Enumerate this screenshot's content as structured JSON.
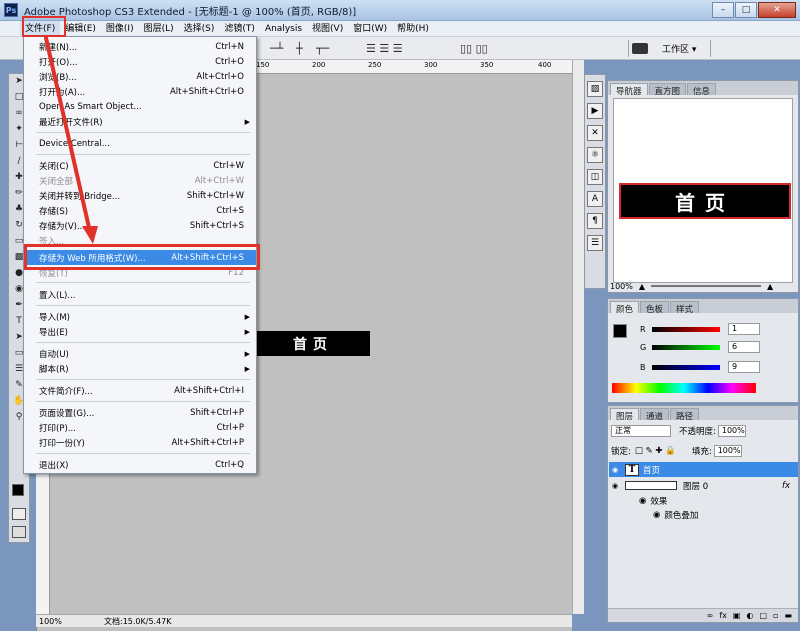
{
  "window": {
    "title": "Adobe Photoshop CS3 Extended - [无标题-1 @ 100% (首页, RGB/8)]",
    "logo": "Ps"
  },
  "menubar": [
    "文件(F)",
    "编辑(E)",
    "图像(I)",
    "图层(L)",
    "选择(S)",
    "滤镜(T)",
    "Analysis",
    "视图(V)",
    "窗口(W)",
    "帮助(H)"
  ],
  "optionsbar": {
    "workspace_label": "工作区 ▾"
  },
  "file_menu": [
    {
      "label": "新建(N)...",
      "shortcut": "Ctrl+N"
    },
    {
      "label": "打开(O)...",
      "shortcut": "Ctrl+O"
    },
    {
      "label": "浏览(B)...",
      "shortcut": "Alt+Ctrl+O"
    },
    {
      "label": "打开为(A)...",
      "shortcut": "Alt+Shift+Ctrl+O"
    },
    {
      "label": "Open As Smart Object...",
      "shortcut": ""
    },
    {
      "label": "最近打开文件(R)",
      "shortcut": "",
      "submenu": true
    },
    {
      "label": "Device Central...",
      "shortcut": ""
    },
    {
      "label": "关闭(C)",
      "shortcut": "Ctrl+W"
    },
    {
      "label": "关闭全部",
      "shortcut": "Alt+Ctrl+W",
      "disabled": true
    },
    {
      "label": "关闭并转到 Bridge...",
      "shortcut": "Shift+Ctrl+W"
    },
    {
      "label": "存储(S)",
      "shortcut": "Ctrl+S"
    },
    {
      "label": "存储为(V)...",
      "shortcut": "Shift+Ctrl+S"
    },
    {
      "label": "签入...",
      "shortcut": "",
      "disabled": true
    },
    {
      "label": "存储为 Web 所用格式(W)...",
      "shortcut": "Alt+Shift+Ctrl+S",
      "highlighted": true
    },
    {
      "label": "恢复(T)",
      "shortcut": "F12",
      "disabled": true
    },
    {
      "label": "置入(L)...",
      "shortcut": ""
    },
    {
      "label": "导入(M)",
      "shortcut": "",
      "submenu": true
    },
    {
      "label": "导出(E)",
      "shortcut": "",
      "submenu": true
    },
    {
      "label": "自动(U)",
      "shortcut": "",
      "submenu": true
    },
    {
      "label": "脚本(R)",
      "shortcut": "",
      "submenu": true
    },
    {
      "label": "文件简介(F)...",
      "shortcut": "Alt+Shift+Ctrl+I"
    },
    {
      "label": "页面设置(G)...",
      "shortcut": "Shift+Ctrl+P"
    },
    {
      "label": "打印(P)...",
      "shortcut": "Ctrl+P"
    },
    {
      "label": "打印一份(Y)",
      "shortcut": "Alt+Shift+Ctrl+P"
    },
    {
      "label": "退出(X)",
      "shortcut": "Ctrl+Q"
    }
  ],
  "document": {
    "canvas_text": "首页",
    "ruler_ticks": [
      "150",
      "200",
      "250",
      "300",
      "350",
      "400"
    ],
    "status_zoom": "100%",
    "status_info": "文档:15.0K/5.47K"
  },
  "navigator_panel": {
    "tabs": [
      "导航器",
      "直方图",
      "信息"
    ],
    "preview_text": "首页",
    "zoom": "100%"
  },
  "color_panel": {
    "tabs": [
      "颜色",
      "色板",
      "样式"
    ],
    "channels": [
      {
        "name": "R",
        "value": "1"
      },
      {
        "name": "G",
        "value": "6"
      },
      {
        "name": "B",
        "value": "9"
      }
    ]
  },
  "layers_panel": {
    "tabs": [
      "图层",
      "通道",
      "路径"
    ],
    "blend_mode": "正常",
    "opacity_label": "不透明度:",
    "opacity_value": "100%",
    "lock_label": "锁定:",
    "fill_label": "填充:",
    "fill_value": "100%",
    "layers": [
      {
        "name": "首页",
        "thumb": "T",
        "selected": true
      },
      {
        "name": "图层 0",
        "fx": "fx"
      },
      {
        "name": "效果"
      },
      {
        "name": "颜色叠加"
      }
    ]
  },
  "colors": {
    "highlight": "#3a8ae6",
    "annotation_red": "#e0312a"
  }
}
